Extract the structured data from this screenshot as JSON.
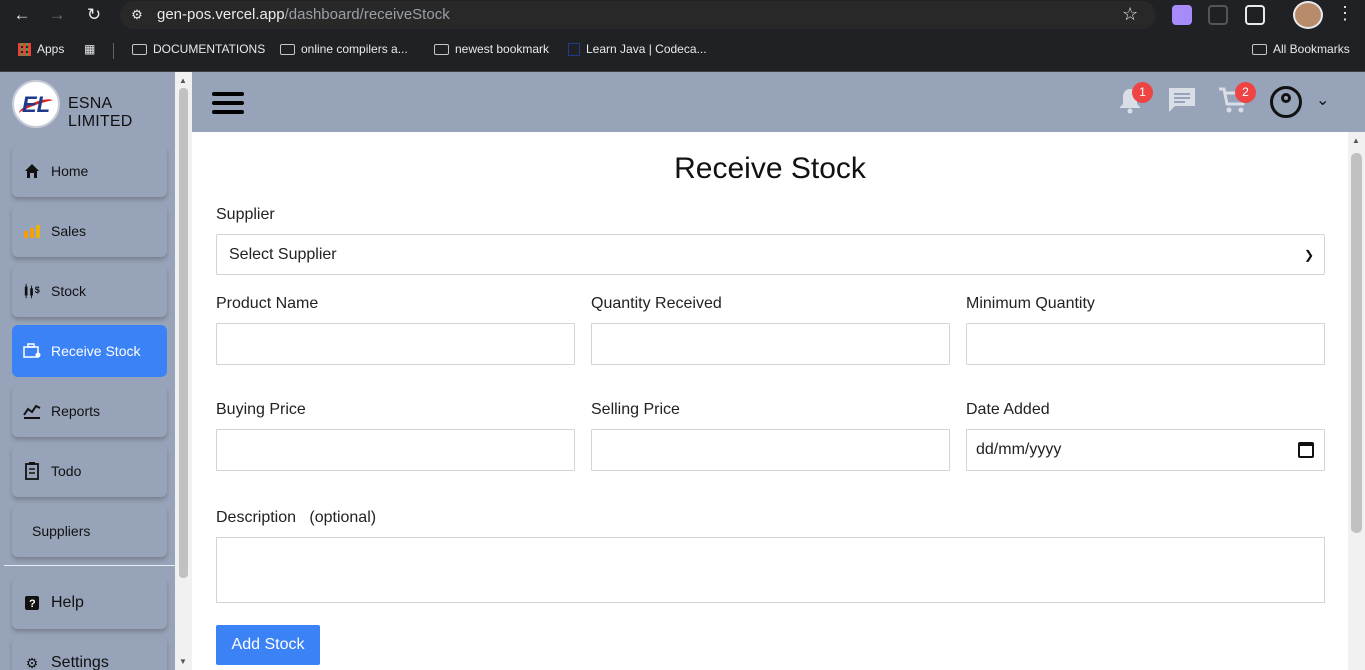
{
  "browser": {
    "url_host": "gen-pos.vercel.app",
    "url_path": "/dashboard/receiveStock",
    "bookmarks": [
      "Apps",
      "DOCUMENTATIONS",
      "online compilers a...",
      "newest bookmark",
      "Learn Java | Codeca...",
      "All Bookmarks"
    ]
  },
  "sidebar": {
    "brand": "ESNA LIMITED",
    "items": [
      {
        "label": "Home",
        "icon": "home-icon"
      },
      {
        "label": "Sales",
        "icon": "sales-icon"
      },
      {
        "label": "Stock",
        "icon": "stock-icon"
      },
      {
        "label": "Receive Stock",
        "icon": "receive-stock-icon",
        "active": true
      },
      {
        "label": "Reports",
        "icon": "reports-icon"
      },
      {
        "label": "Todo",
        "icon": "todo-icon"
      },
      {
        "label": "Suppliers",
        "icon": ""
      },
      {
        "label": "Help",
        "icon": "help-icon"
      },
      {
        "label": "Settings",
        "icon": "settings-icon"
      }
    ],
    "active_color": "#3b82f6"
  },
  "header": {
    "notifications_count": "1",
    "cart_count": "2"
  },
  "form": {
    "title": "Receive Stock",
    "supplier_label": "Supplier",
    "supplier_value": "Select Supplier",
    "product_name_label": "Product Name",
    "quantity_received_label": "Quantity Received",
    "minimum_quantity_label": "Minimum Quantity",
    "buying_price_label": "Buying Price",
    "selling_price_label": "Selling Price",
    "date_added_label": "Date Added",
    "date_placeholder": "dd/mm/yyyy",
    "description_label": "Description",
    "description_hint": "(optional)",
    "submit_label": "Add Stock"
  }
}
